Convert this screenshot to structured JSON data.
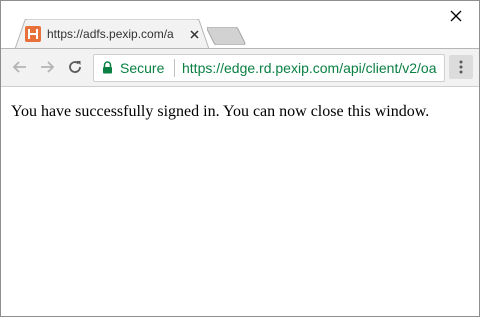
{
  "window": {
    "close_icon": "close-icon"
  },
  "tab": {
    "title": "https://adfs.pexip.com/a",
    "favicon_icon": "pexip-logo-icon",
    "favicon_color": "#e8703a",
    "close_icon": "close-icon"
  },
  "toolbar": {
    "back_icon": "arrow-left-icon",
    "forward_icon": "arrow-right-icon",
    "reload_icon": "reload-icon",
    "menu_icon": "vertical-dots-icon"
  },
  "omnibox": {
    "security_icon": "lock-icon",
    "secure_label": "Secure",
    "url": "https://edge.rd.pexip.com/api/client/v2/oa",
    "secure_color": "#0b8043"
  },
  "page": {
    "message": "You have successfully signed in. You can now close this window."
  }
}
